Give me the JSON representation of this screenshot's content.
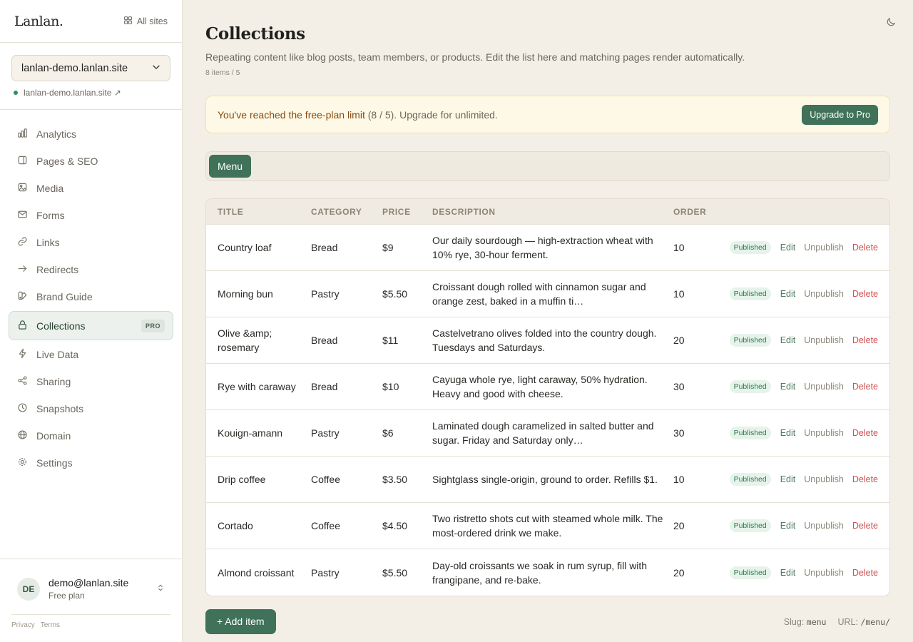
{
  "sidebar": {
    "logo": "Lanlan.",
    "all_sites": "All sites",
    "site_select": "lanlan-demo.lanlan.site",
    "site_link": "lanlan-demo.lanlan.site ↗",
    "nav": [
      {
        "label": "Analytics",
        "icon": "bar-chart-icon"
      },
      {
        "label": "Pages & SEO",
        "icon": "page-icon"
      },
      {
        "label": "Media",
        "icon": "image-icon"
      },
      {
        "label": "Forms",
        "icon": "mail-icon"
      },
      {
        "label": "Links",
        "icon": "link-icon"
      },
      {
        "label": "Redirects",
        "icon": "arrow-right-icon"
      },
      {
        "label": "Brand Guide",
        "icon": "palette-icon"
      },
      {
        "label": "Collections",
        "icon": "lock-icon",
        "badge": "PRO",
        "active": true
      },
      {
        "label": "Live Data",
        "icon": "bolt-icon"
      },
      {
        "label": "Sharing",
        "icon": "share-icon"
      },
      {
        "label": "Snapshots",
        "icon": "clock-icon"
      },
      {
        "label": "Domain",
        "icon": "globe-icon"
      },
      {
        "label": "Settings",
        "icon": "gear-icon"
      }
    ],
    "user": {
      "initials": "DE",
      "email": "demo@lanlan.site",
      "plan": "Free plan"
    },
    "legal": {
      "privacy": "Privacy",
      "terms": "Terms"
    }
  },
  "main": {
    "title": "Collections",
    "description": "Repeating content like blog posts, team members, or products. Edit the list here and matching pages render automatically.",
    "count": "8 items / 5",
    "banner": {
      "strong": "You've reached the free-plan limit",
      "rest": " (8 / 5). Upgrade for unlimited.",
      "button": "Upgrade to Pro"
    },
    "tab": "Menu",
    "table": {
      "headers": [
        "TITLE",
        "CATEGORY",
        "PRICE",
        "DESCRIPTION",
        "ORDER"
      ],
      "rows": [
        {
          "title": "Country loaf",
          "category": "Bread",
          "price": "$9",
          "description": "Our daily sourdough — high-extraction wheat with 10% rye, 30-hour ferment.",
          "order": "10",
          "status": "Published"
        },
        {
          "title": "Morning bun",
          "category": "Pastry",
          "price": "$5.50",
          "description": "Croissant dough rolled with cinnamon sugar and orange zest, baked in a muffin ti…",
          "order": "10",
          "status": "Published"
        },
        {
          "title": "Olive &amp; rosemary",
          "category": "Bread",
          "price": "$11",
          "description": "Castelvetrano olives folded into the country dough. Tuesdays and Saturdays.",
          "order": "20",
          "status": "Published"
        },
        {
          "title": "Rye with caraway",
          "category": "Bread",
          "price": "$10",
          "description": "Cayuga whole rye, light caraway, 50% hydration. Heavy and good with cheese.",
          "order": "30",
          "status": "Published"
        },
        {
          "title": "Kouign-amann",
          "category": "Pastry",
          "price": "$6",
          "description": "Laminated dough caramelized in salted butter and sugar. Friday and Saturday only…",
          "order": "30",
          "status": "Published"
        },
        {
          "title": "Drip coffee",
          "category": "Coffee",
          "price": "$3.50",
          "description": "Sightglass single-origin, ground to order. Refills $1.",
          "order": "10",
          "status": "Published"
        },
        {
          "title": "Cortado",
          "category": "Coffee",
          "price": "$4.50",
          "description": "Two ristretto shots cut with steamed whole milk. The most-ordered drink we make.",
          "order": "20",
          "status": "Published"
        },
        {
          "title": "Almond croissant",
          "category": "Pastry",
          "price": "$5.50",
          "description": "Day-old croissants we soak in rum syrup, fill with frangipane, and re-bake.",
          "order": "20",
          "status": "Published"
        }
      ],
      "actions": {
        "edit": "Edit",
        "unpublish": "Unpublish",
        "delete": "Delete"
      }
    },
    "add_item": "+ Add item",
    "slug_label": "Slug:",
    "slug_value": "menu",
    "url_label": "URL:",
    "url_value": "/menu/"
  },
  "colors": {
    "accent": "#3f7258",
    "danger": "#d04f4f",
    "background": "#f3efe7"
  }
}
